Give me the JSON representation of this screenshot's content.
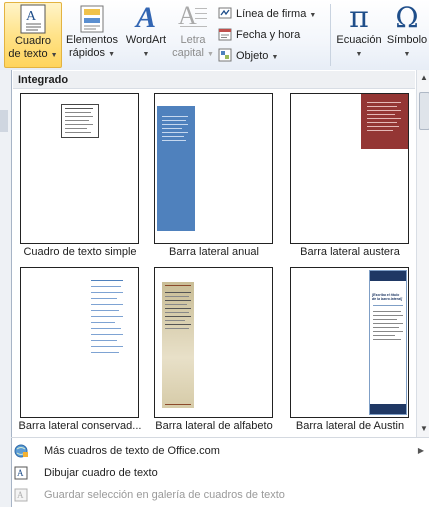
{
  "ribbon": {
    "cuadro": {
      "line1": "Cuadro",
      "line2": "de texto"
    },
    "elementos": {
      "line1": "Elementos",
      "line2": "rápidos"
    },
    "wordart": {
      "line1": "WordArt"
    },
    "letra": {
      "line1": "Letra",
      "line2": "capital"
    },
    "linea_firma": "Línea de firma",
    "fecha_hora": "Fecha y hora",
    "objeto": "Objeto",
    "ecuacion": "Ecuación",
    "simbolo": "Símbolo",
    "ecuacion_glyph": "π",
    "simbolo_glyph": "Ω",
    "wordart_glyph": "A",
    "letra_glyph": "A"
  },
  "gallery": {
    "section_title": "Integrado",
    "items": [
      {
        "caption": "Cuadro de texto simple"
      },
      {
        "caption": "Barra lateral anual"
      },
      {
        "caption": "Barra lateral austera"
      },
      {
        "caption": "Barra lateral conservad..."
      },
      {
        "caption": "Barra lateral de alfabeto"
      },
      {
        "caption": "Barra lateral de Austin"
      }
    ],
    "austin_heading": "[Escriba el título de la barra lateral]"
  },
  "menu": {
    "more": "Más cuadros de texto de Office.com",
    "draw": "Dibujar cuadro de texto",
    "save": "Guardar selección en galería de cuadros de texto"
  },
  "colors": {
    "selected_bg": "#ffe38a",
    "anual_blue": "#4f81bd",
    "austera_red": "#943634",
    "austin_navy": "#1f3864",
    "alfabeto_tan": "#d6cba8"
  },
  "icons": [
    "text-box-icon",
    "quick-parts-icon",
    "wordart-icon",
    "drop-cap-icon",
    "signature-line-icon",
    "date-time-icon",
    "object-icon",
    "equation-icon",
    "symbol-icon",
    "office-globe-icon",
    "draw-textbox-icon",
    "save-selection-icon"
  ]
}
